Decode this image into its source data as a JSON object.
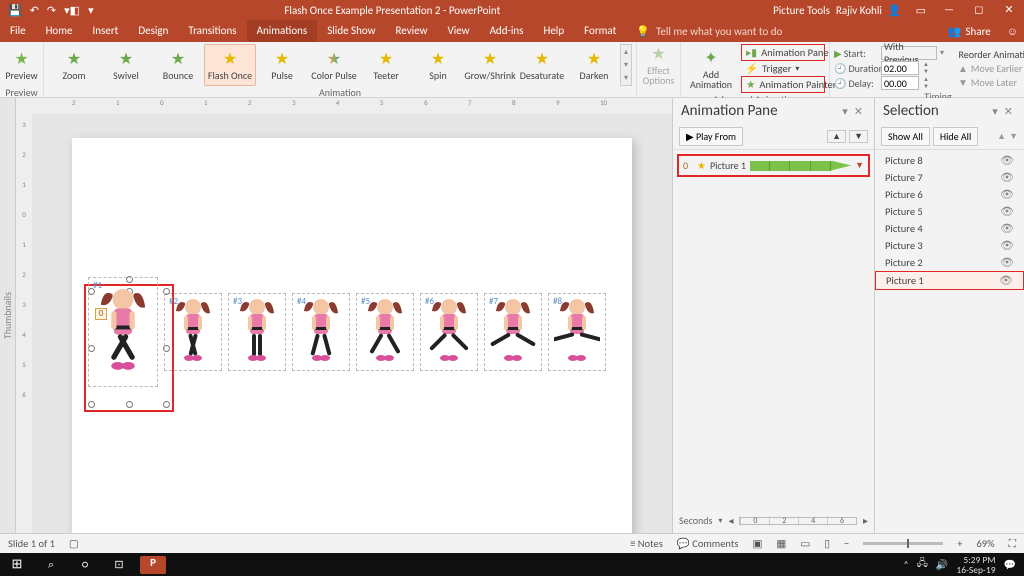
{
  "titlebar": {
    "title": "Flash Once Example Presentation 2  -  PowerPoint",
    "contextual": "Picture Tools",
    "user": "Rajiv Kohli"
  },
  "tabs": {
    "file": "File",
    "list": [
      "Home",
      "Insert",
      "Design",
      "Transitions",
      "Animations",
      "Slide Show",
      "Review",
      "View",
      "Add-ins",
      "Help",
      "Format"
    ],
    "active": "Animations",
    "ctx": "Format",
    "tell": "Tell me what you want to do",
    "share": "Share"
  },
  "ribbon": {
    "preview": "Preview",
    "effects": [
      "Zoom",
      "Swivel",
      "Bounce",
      "Flash Once",
      "Pulse",
      "Color Pulse",
      "Teeter",
      "Spin",
      "Grow/Shrink",
      "Desaturate",
      "Darken"
    ],
    "selected": "Flash Once",
    "effectOptions": "Effect\nOptions",
    "addAnimation": "Add\nAnimation",
    "animationPane": "Animation Pane",
    "trigger": "Trigger",
    "animationPainter": "Animation Painter",
    "advanced": "Advanced Animation",
    "animation": "Animation",
    "timing": {
      "group": "Timing",
      "startLbl": "Start:",
      "startVal": "With Previous",
      "durLbl": "Duration:",
      "durVal": "02.00",
      "delayLbl": "Delay:",
      "delayVal": "00.00"
    },
    "reorder": {
      "hdr": "Reorder Animation",
      "up": "Move Earlier",
      "down": "Move Later"
    }
  },
  "workspace": {
    "thumbnails": "Thumbnails",
    "rulerH": [
      "2",
      "1",
      "0",
      "1",
      "2",
      "3",
      "4",
      "5",
      "6",
      "7",
      "8",
      "9",
      "10"
    ],
    "rulerV": [
      "3",
      "2",
      "1",
      "0",
      "1",
      "2",
      "3",
      "4",
      "5",
      "6"
    ],
    "tag": "0",
    "figures": [
      "#1",
      "#2",
      "#3",
      "#4",
      "#5",
      "#6",
      "#7",
      "#8"
    ]
  },
  "animPane": {
    "title": "Animation Pane",
    "play": "Play From",
    "item": {
      "idx": "0",
      "name": "Picture 1"
    },
    "seconds": "Seconds",
    "scale": [
      "0",
      "2",
      "4",
      "6"
    ]
  },
  "selPane": {
    "title": "Selection",
    "showAll": "Show All",
    "hideAll": "Hide All",
    "items": [
      "Picture 8",
      "Picture 7",
      "Picture 6",
      "Picture 5",
      "Picture 4",
      "Picture 3",
      "Picture 2",
      "Picture 1"
    ],
    "highlight": "Picture 1"
  },
  "status": {
    "slide": "Slide 1 of 1",
    "notes": "Notes",
    "comments": "Comments",
    "zoom": "69%"
  },
  "taskbar": {
    "time": "5:29 PM",
    "date": "16-Sep-19"
  }
}
